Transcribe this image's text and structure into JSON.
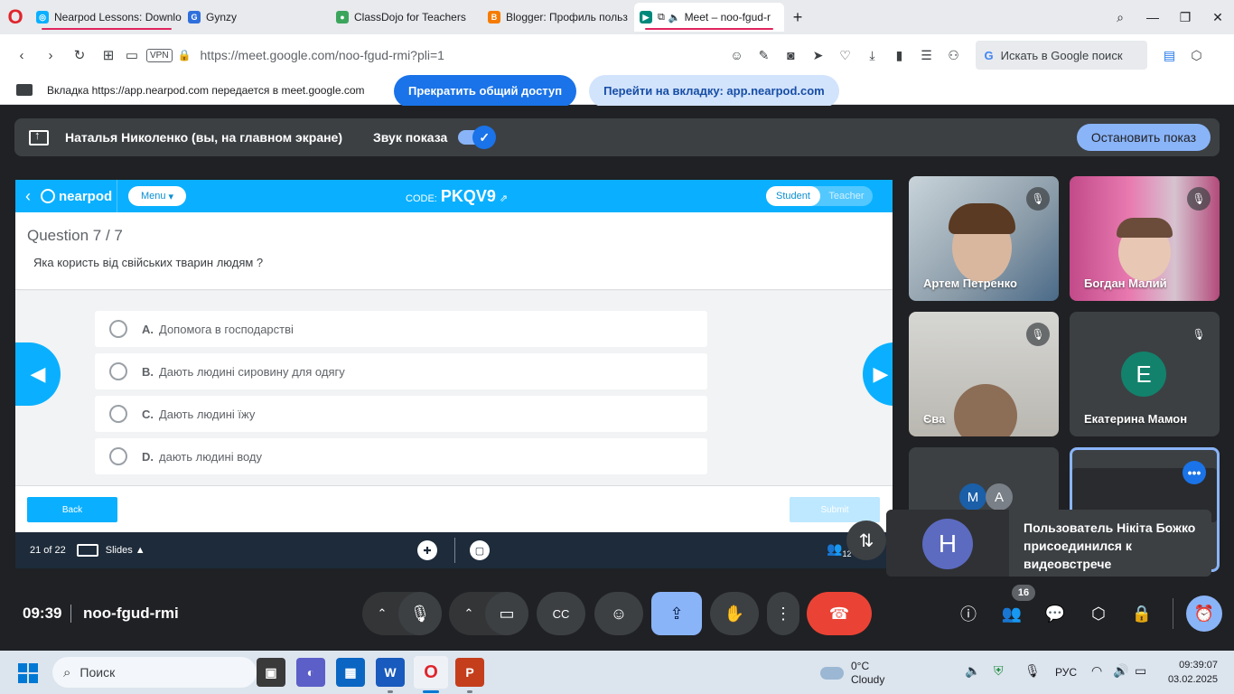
{
  "browser": {
    "tabs": [
      {
        "label": "Nearpod Lessons: Downlo",
        "icon": "nearpod-icon",
        "color": "#0ab0ff"
      },
      {
        "label": "Gynzy",
        "icon": "gynzy-icon",
        "color": "#2f6fdc"
      },
      {
        "label": "ClassDojo for Teachers",
        "icon": "classdojo-icon",
        "color": "#3ba55c"
      },
      {
        "label": "Blogger: Профиль польз",
        "icon": "blogger-icon",
        "color": "#f57c00"
      },
      {
        "label": "Meet – noo-fgud-r",
        "icon": "meet-icon",
        "color": "#00897b",
        "active": true
      }
    ],
    "url": "https://meet.google.com/noo-fgud-rmi?pli=1",
    "vpn_label": "VPN",
    "search_placeholder": "Искать в Google поиск"
  },
  "share_bar": {
    "message": "Вкладка https://app.nearpod.com передается в meet.google.com",
    "stop_label": "Прекратить общий доступ",
    "switch_label": "Перейти на вкладку: app.nearpod.com"
  },
  "presenter_bar": {
    "presenter": "Наталья Николенко (вы, на главном экране)",
    "sound_label": "Звук показа",
    "sound_on": true,
    "stop_label": "Остановить показ"
  },
  "nearpod": {
    "logo": "nearpod",
    "menu_label": "Menu",
    "code_label": "CODE:",
    "code": "PKQV9",
    "mode_student": "Student",
    "mode_teacher": "Teacher",
    "question_number": "Question 7 / 7",
    "question": "Яка користь від свійських тварин людям ?",
    "options": [
      {
        "letter": "A.",
        "text": "Допомога в господарстві"
      },
      {
        "letter": "B.",
        "text": "Дають людині сировину для одягу"
      },
      {
        "letter": "C.",
        "text": "Дають людині їжу"
      },
      {
        "letter": "D.",
        "text": "дають людині воду"
      }
    ],
    "back_label": "Back",
    "submit_label": "Submit",
    "slide_count": "21 of 22",
    "slides_label": "Slides",
    "participants_badge": "12"
  },
  "participants": [
    {
      "name": "Артем Петренко",
      "muted": true
    },
    {
      "name": "Богдан Малий",
      "muted": true
    },
    {
      "name": "Єва",
      "muted": true
    },
    {
      "name": "Екатерина Мамон",
      "muted": true,
      "initial": "Е"
    },
    {
      "initials": [
        "М",
        "А"
      ]
    },
    {
      "self": true
    }
  ],
  "toast": {
    "initial": "Н",
    "message": "Пользователь Нікіта Божко присоединился к видеовстрече"
  },
  "meet_controls": {
    "time": "09:39",
    "meeting_code": "noo-fgud-rmi",
    "people_count": "16",
    "end_call_color": "#ea4335",
    "present_color": "#8ab4f8"
  },
  "taskbar": {
    "search_label": "Поиск",
    "weather_temp": "0°C",
    "weather_desc": "Cloudy",
    "lang": "РУС",
    "time": "09:39:07",
    "date": "03.02.2025"
  }
}
